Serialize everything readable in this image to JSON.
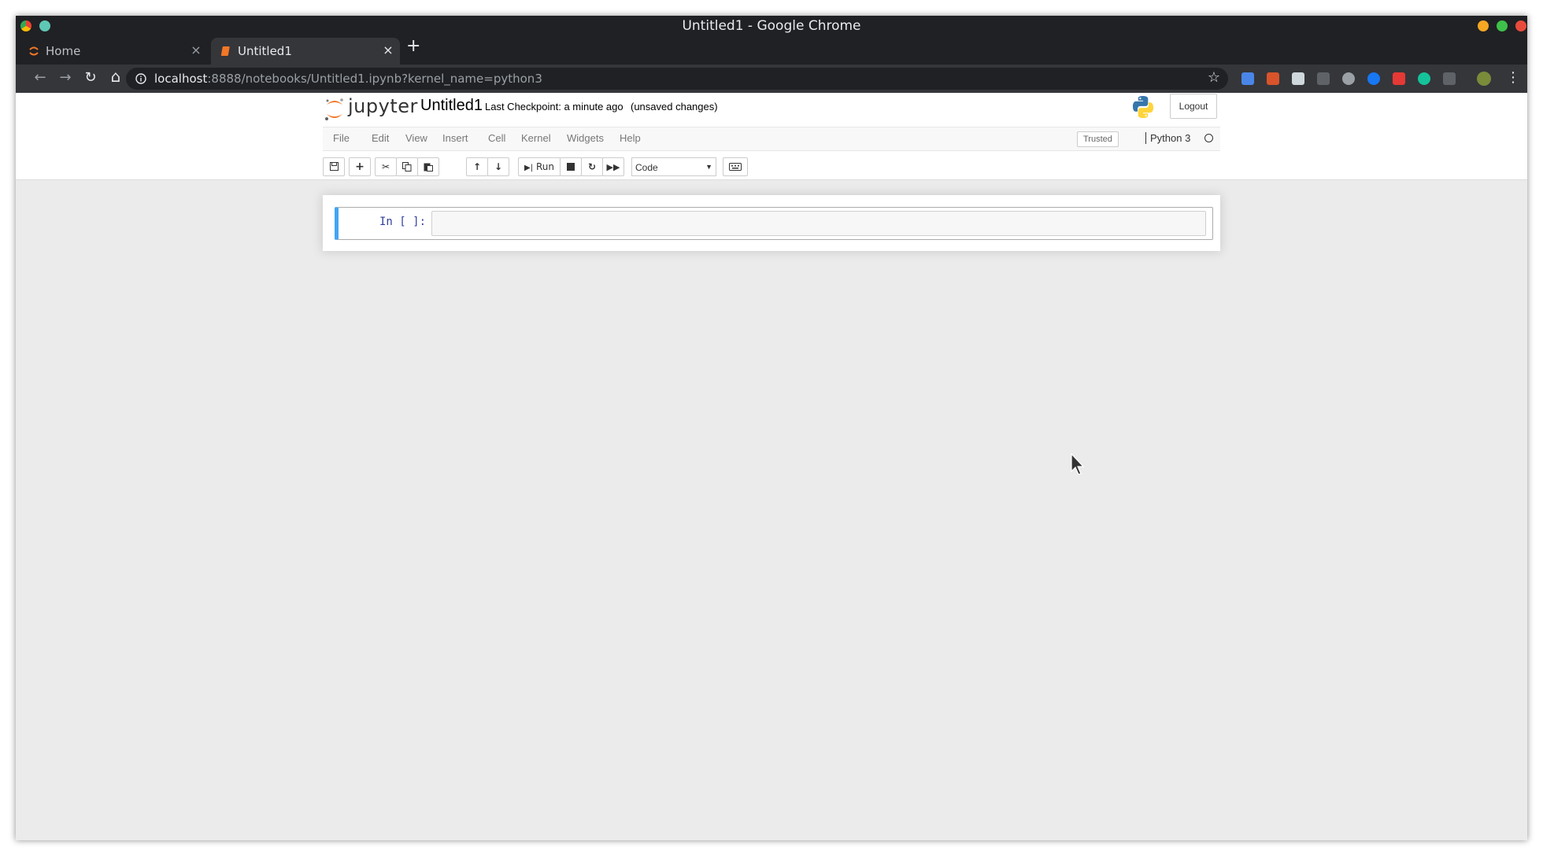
{
  "window": {
    "title": "Untitled1 - Google Chrome"
  },
  "tabs": [
    {
      "label": "Home",
      "close": "×"
    },
    {
      "label": "Untitled1",
      "close": "×"
    }
  ],
  "new_tab": "+",
  "toolbar": {
    "back": "←",
    "forward": "→",
    "reload": "↻",
    "home": "⌂",
    "url_host": "localhost",
    "url_rest": ":8888/notebooks/Untitled1.ipynb?kernel_name=python3",
    "bookmark": "☆",
    "menu": "⋮"
  },
  "jupyter": {
    "logo_text": "jupyter",
    "notebook_name": "Untitled1",
    "checkpoint": "Last Checkpoint: a minute ago",
    "unsaved": "(unsaved changes)",
    "logout": "Logout",
    "menu": [
      "File",
      "Edit",
      "View",
      "Insert",
      "Cell",
      "Kernel",
      "Widgets",
      "Help"
    ],
    "trusted": "Trusted",
    "kernel": "Python 3",
    "run_label": "Run",
    "cell_type": "Code",
    "icons": {
      "save": "save-icon",
      "insert": "plus-icon",
      "cut": "scissors-icon",
      "copy": "copy-icon",
      "paste": "paste-icon",
      "up": "arrow-up-icon",
      "down": "arrow-down-icon",
      "run": "step-forward-icon",
      "stop": "stop-icon",
      "restart": "restart-icon",
      "run_all": "fast-forward-icon",
      "keyboard": "keyboard-icon"
    }
  },
  "cell": {
    "prompt": "In [ ]:",
    "code": ""
  },
  "colors": {
    "chrome_frame": "#202124",
    "toolbar": "#35363a",
    "selected_cell": "#42a5f5",
    "prompt": "#303f9f",
    "notebook_bg": "#ebebeb"
  }
}
